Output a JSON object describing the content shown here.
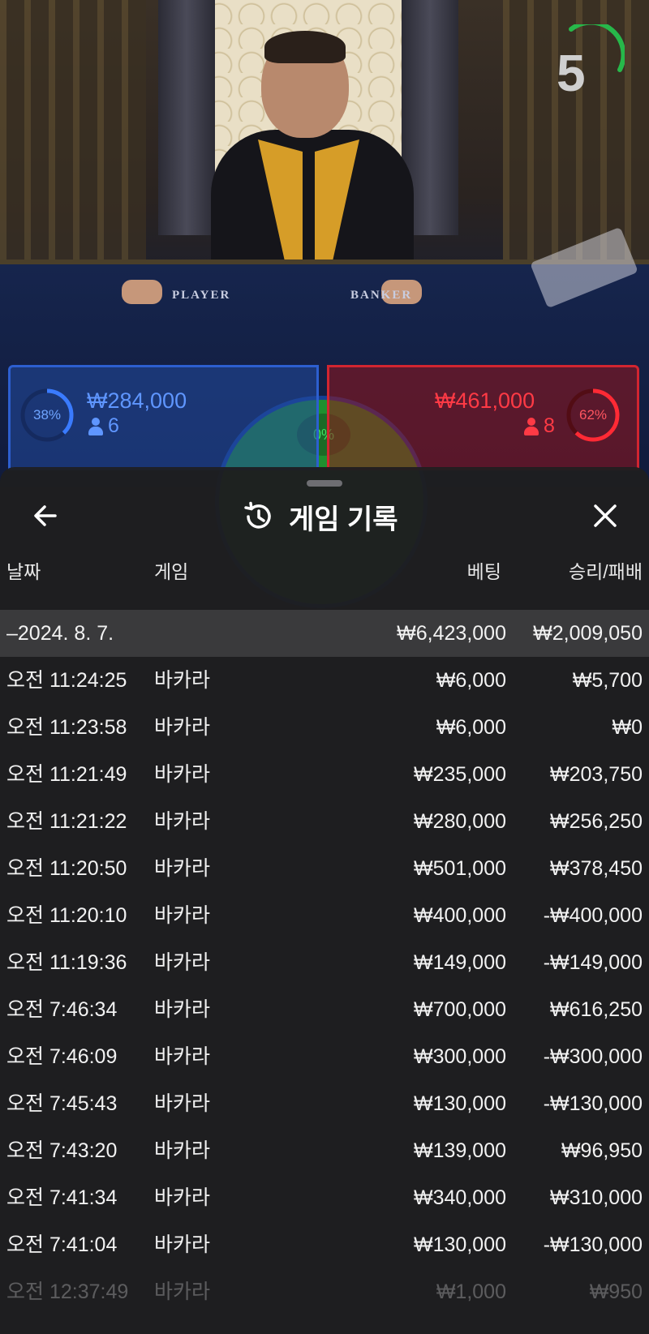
{
  "stage": {
    "table_player_label": "PLAYER",
    "table_banker_label": "BANKER",
    "timer": "5"
  },
  "bets": {
    "player": {
      "pct": "38%",
      "amount": "₩284,000",
      "count": "6",
      "color": "#2d5fd0"
    },
    "banker": {
      "pct": "62%",
      "amount": "₩461,000",
      "count": "8",
      "color": "#d22530"
    },
    "tie": {
      "pct": "0%",
      "color": "#1f8f2f"
    }
  },
  "sheet": {
    "title": "게임 기록",
    "back_icon": "arrow-left-icon",
    "title_icon": "history-icon",
    "close_icon": "close-icon",
    "columns": {
      "date": "날짜",
      "game": "게임",
      "bet": "베팅",
      "winloss": "승리/패배"
    },
    "summary": {
      "date": "–2024. 8. 7.",
      "bet": "₩6,423,000",
      "winloss": "₩2,009,050"
    },
    "rows": [
      {
        "time": "오전 11:24:25",
        "game": "바카라",
        "bet": "₩6,000",
        "winloss": "₩5,700"
      },
      {
        "time": "오전 11:23:58",
        "game": "바카라",
        "bet": "₩6,000",
        "winloss": "₩0"
      },
      {
        "time": "오전 11:21:49",
        "game": "바카라",
        "bet": "₩235,000",
        "winloss": "₩203,750"
      },
      {
        "time": "오전 11:21:22",
        "game": "바카라",
        "bet": "₩280,000",
        "winloss": "₩256,250"
      },
      {
        "time": "오전 11:20:50",
        "game": "바카라",
        "bet": "₩501,000",
        "winloss": "₩378,450"
      },
      {
        "time": "오전 11:20:10",
        "game": "바카라",
        "bet": "₩400,000",
        "winloss": "-₩400,000"
      },
      {
        "time": "오전 11:19:36",
        "game": "바카라",
        "bet": "₩149,000",
        "winloss": "-₩149,000"
      },
      {
        "time": "오전 7:46:34",
        "game": "바카라",
        "bet": "₩700,000",
        "winloss": "₩616,250"
      },
      {
        "time": "오전 7:46:09",
        "game": "바카라",
        "bet": "₩300,000",
        "winloss": "-₩300,000"
      },
      {
        "time": "오전 7:45:43",
        "game": "바카라",
        "bet": "₩130,000",
        "winloss": "-₩130,000"
      },
      {
        "time": "오전 7:43:20",
        "game": "바카라",
        "bet": "₩139,000",
        "winloss": "₩96,950"
      },
      {
        "time": "오전 7:41:34",
        "game": "바카라",
        "bet": "₩340,000",
        "winloss": "₩310,000"
      },
      {
        "time": "오전 7:41:04",
        "game": "바카라",
        "bet": "₩130,000",
        "winloss": "-₩130,000"
      }
    ],
    "faded_row": {
      "time": "오전 12:37:49",
      "game": "바카라",
      "bet": "₩1,000",
      "winloss": "₩950"
    }
  }
}
